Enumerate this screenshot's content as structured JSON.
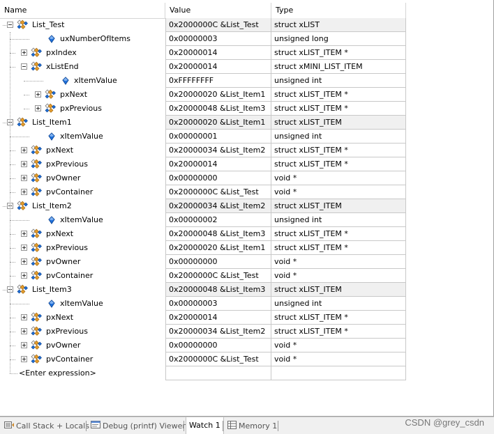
{
  "columns": {
    "name": "Name",
    "value": "Value",
    "type": "Type"
  },
  "rows": [
    {
      "name": "List_Test",
      "value": "0x2000000C &List_Test",
      "type": "struct xLIST",
      "level": 0,
      "toggle": "minus",
      "icon": "struct",
      "root": true
    },
    {
      "name": "uxNumberOfItems",
      "value": "0x00000003",
      "type": "unsigned long",
      "level": 1,
      "toggle": "none",
      "icon": "value"
    },
    {
      "name": "pxIndex",
      "value": "0x20000014",
      "type": "struct xLIST_ITEM *",
      "level": 1,
      "toggle": "plus",
      "icon": "struct"
    },
    {
      "name": "xListEnd",
      "value": "0x20000014",
      "type": "struct xMINI_LIST_ITEM",
      "level": 1,
      "toggle": "minus",
      "icon": "struct"
    },
    {
      "name": "xItemValue",
      "value": "0xFFFFFFFF",
      "type": "unsigned int",
      "level": 2,
      "toggle": "none",
      "icon": "value"
    },
    {
      "name": "pxNext",
      "value": "0x20000020 &List_Item1",
      "type": "struct xLIST_ITEM *",
      "level": 2,
      "toggle": "plus",
      "icon": "struct"
    },
    {
      "name": "pxPrevious",
      "value": "0x20000048 &List_Item3",
      "type": "struct xLIST_ITEM *",
      "level": 2,
      "toggle": "plus",
      "icon": "struct"
    },
    {
      "name": "List_Item1",
      "value": "0x20000020 &List_Item1",
      "type": "struct xLIST_ITEM",
      "level": 0,
      "toggle": "minus",
      "icon": "struct",
      "root": true
    },
    {
      "name": "xItemValue",
      "value": "0x00000001",
      "type": "unsigned int",
      "level": 1,
      "toggle": "none",
      "icon": "value"
    },
    {
      "name": "pxNext",
      "value": "0x20000034 &List_Item2",
      "type": "struct xLIST_ITEM *",
      "level": 1,
      "toggle": "plus",
      "icon": "struct"
    },
    {
      "name": "pxPrevious",
      "value": "0x20000014",
      "type": "struct xLIST_ITEM *",
      "level": 1,
      "toggle": "plus",
      "icon": "struct"
    },
    {
      "name": "pvOwner",
      "value": "0x00000000",
      "type": "void *",
      "level": 1,
      "toggle": "plus",
      "icon": "struct"
    },
    {
      "name": "pvContainer",
      "value": "0x2000000C &List_Test",
      "type": "void *",
      "level": 1,
      "toggle": "plus",
      "icon": "struct"
    },
    {
      "name": "List_Item2",
      "value": "0x20000034 &List_Item2",
      "type": "struct xLIST_ITEM",
      "level": 0,
      "toggle": "minus",
      "icon": "struct",
      "root": true
    },
    {
      "name": "xItemValue",
      "value": "0x00000002",
      "type": "unsigned int",
      "level": 1,
      "toggle": "none",
      "icon": "value"
    },
    {
      "name": "pxNext",
      "value": "0x20000048 &List_Item3",
      "type": "struct xLIST_ITEM *",
      "level": 1,
      "toggle": "plus",
      "icon": "struct"
    },
    {
      "name": "pxPrevious",
      "value": "0x20000020 &List_Item1",
      "type": "struct xLIST_ITEM *",
      "level": 1,
      "toggle": "plus",
      "icon": "struct"
    },
    {
      "name": "pvOwner",
      "value": "0x00000000",
      "type": "void *",
      "level": 1,
      "toggle": "plus",
      "icon": "struct"
    },
    {
      "name": "pvContainer",
      "value": "0x2000000C &List_Test",
      "type": "void *",
      "level": 1,
      "toggle": "plus",
      "icon": "struct"
    },
    {
      "name": "List_Item3",
      "value": "0x20000048 &List_Item3",
      "type": "struct xLIST_ITEM",
      "level": 0,
      "toggle": "minus",
      "icon": "struct",
      "root": true
    },
    {
      "name": "xItemValue",
      "value": "0x00000003",
      "type": "unsigned int",
      "level": 1,
      "toggle": "none",
      "icon": "value"
    },
    {
      "name": "pxNext",
      "value": "0x20000014",
      "type": "struct xLIST_ITEM *",
      "level": 1,
      "toggle": "plus",
      "icon": "struct"
    },
    {
      "name": "pxPrevious",
      "value": "0x20000034 &List_Item2",
      "type": "struct xLIST_ITEM *",
      "level": 1,
      "toggle": "plus",
      "icon": "struct"
    },
    {
      "name": "pvOwner",
      "value": "0x00000000",
      "type": "void *",
      "level": 1,
      "toggle": "plus",
      "icon": "struct"
    },
    {
      "name": "pvContainer",
      "value": "0x2000000C &List_Test",
      "type": "void *",
      "level": 1,
      "toggle": "plus",
      "icon": "struct"
    }
  ],
  "enter_expression": "<Enter expression>",
  "tabs": [
    {
      "label": "Call Stack + Locals",
      "icon": "call-stack-icon",
      "active": false
    },
    {
      "label": "Debug (printf) Viewer",
      "icon": "debug-viewer-icon",
      "active": false
    },
    {
      "label": "Watch 1",
      "icon": "",
      "active": true
    },
    {
      "label": "Memory 1",
      "icon": "memory-icon",
      "active": false
    }
  ],
  "watermark": "CSDN @grey_csdn",
  "colors": {
    "root_row_bg": "#f0f0f0",
    "grid": "#c8c8c8",
    "icon_blue": "#1e6fd9",
    "icon_orange": "#e39b2b"
  }
}
